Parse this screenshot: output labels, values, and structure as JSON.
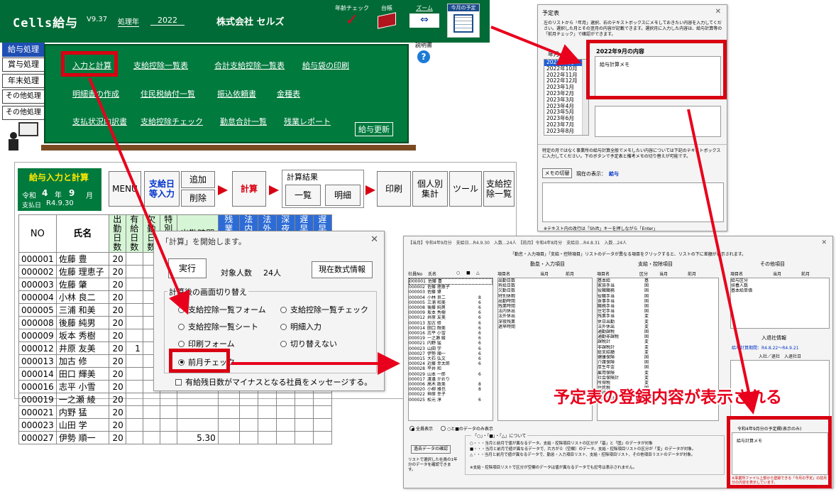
{
  "header": {
    "app_name": "Cells給与",
    "version": "V9.37",
    "year_label": "処理年",
    "year": "2022",
    "company": "株式会社 セルズ",
    "age_check": "年齢チェック",
    "ledger": "台帳",
    "zoom": "ズーム",
    "month_plan": "今月の予定"
  },
  "side_menu": [
    "給与処理",
    "賞与処理",
    "年末処理",
    "その他処理 A",
    "その他処理 B"
  ],
  "help_label": "説明書",
  "menu": {
    "row1": [
      "入力と計算",
      "支給控除一覧表",
      "合計支給控除一覧表",
      "給与袋の印刷"
    ],
    "row2": [
      "明細書の作成",
      "住民税納付一覧",
      "振込依頼書",
      "金種表"
    ],
    "row3": [
      "支払状況内訳書",
      "支給控除チェック",
      "勤怠合計一覧",
      "残業レポート"
    ],
    "update": "給与更新"
  },
  "pay": {
    "title": "給与入力と計算",
    "era": "令和",
    "era_year": "4",
    "year_suffix": "年",
    "month": "9",
    "month_suffix": "月",
    "pay_date_label": "支払日",
    "pay_date": "R4.9.30",
    "buttons": {
      "menu": "MENU",
      "date_input": "支給日等入力",
      "add": "追加",
      "delete": "削除",
      "calc": "計算",
      "result_label": "計算結果",
      "list": "一覧",
      "detail": "明細",
      "print": "印刷",
      "individual": "個人別集計",
      "tools": "ツール",
      "summary": "支給控除一覧"
    },
    "columns": [
      "NO",
      "氏名",
      "出勤日数",
      "有給日数",
      "欠勤日数",
      "特別休暇",
      "出勤時間",
      "残業時間",
      "法内休出",
      "法外休出",
      "深夜残業",
      "遅早回数",
      "遅早時間"
    ],
    "rows": [
      [
        "000001",
        "佐藤 豊",
        "20"
      ],
      [
        "000002",
        "佐藤 理恵子",
        "20"
      ],
      [
        "000003",
        "佐藤 肇",
        "20"
      ],
      [
        "000004",
        "小林 良二",
        "20"
      ],
      [
        "000005",
        "三浦 和美",
        "20"
      ],
      [
        "000008",
        "後藤 純男",
        "20"
      ],
      [
        "000009",
        "坂本 秀樹",
        "20"
      ],
      [
        "000012",
        "井原 友美",
        "20"
      ],
      [
        "000013",
        "加古 修",
        "20"
      ],
      [
        "000014",
        "田口 輝美",
        "20"
      ],
      [
        "000016",
        "志平 小雪",
        "20"
      ],
      [
        "000019",
        "一之瀬 綾",
        "20"
      ],
      [
        "000021",
        "内野 猛",
        "20"
      ],
      [
        "000023",
        "山田 学",
        "20"
      ],
      [
        "000027",
        "伊勢 順一",
        "20"
      ]
    ],
    "extra_one": "1",
    "extra_time": "5.30"
  },
  "calc_dialog": {
    "title": "「計算」を開始します。",
    "run": "実行",
    "target_label": "対象人数",
    "target_count": "24人",
    "formula_info": "現在数式情報",
    "group_label": "計算後の画面切り替え",
    "options_left": [
      "支給控除一覧フォーム",
      "支給控除一覧シート",
      "印刷フォーム",
      "前月チェック"
    ],
    "options_right": [
      "支給控除一覧チェック",
      "明細入力",
      "切り替えない"
    ],
    "selected": "前月チェック",
    "checkbox": "有給残日数がマイナスとなる社員をメッセージする。"
  },
  "schedule": {
    "title": "予定表",
    "instructions": "左のリストから「年月」選択、右のテキストボックスにメモしておきたい内容を入力してください。選択した月とその翌月の内容が記載できます。選択月に入力した内容は、給与計算等の「前月チェック」で確認ができます。",
    "year_month_label": "年月",
    "months": [
      "2022年9月",
      "2022年10月",
      "2022年11月",
      "2022年12月",
      "2023年1月",
      "2023年2月",
      "2023年3月",
      "2023年4月",
      "2023年5月",
      "2023年6月",
      "2023年7月",
      "2023年8月"
    ],
    "content_title": "2022年9月の内容",
    "memo": "給与計算メモ",
    "lower_text": "特定の月ではなく事業所の給与計算全般でメモしたい内容については下記のテキストボックスに入力してください。下のボタンで予定表と備考メモの切り替えが可能です。",
    "toggle_btn": "メモの切替",
    "current_label": "現在の表示：",
    "current_value": "給与",
    "footer": "※テキスト内の改行は「Shift」キーを押しながら「Enter」"
  },
  "check": {
    "title": "【当月】令和4年9月分　支給日…R4.9.30　入数…24人　【前月】令和4年8月分　支給日…R4.8.31　入数…24人",
    "header_note": "「勤怠・入力項目」「支給・控除項目」リストのデータが異なる項目をクリックすると、リストの下に差額が表示されます。",
    "group_attendance": "勤怠・入力項目",
    "group_pay": "支給・控除項目",
    "group_other": "その他項目",
    "emp_headers": [
      "社員No",
      "氏名",
      "○",
      "■",
      "△"
    ],
    "item_headers": [
      "項目名",
      "当月",
      "前月"
    ],
    "pay_headers": [
      "項目名",
      "区分",
      "当月",
      "前月"
    ],
    "employees": [
      [
        "000001",
        "佐藤 豊"
      ],
      [
        "000002",
        "佐藤 理恵子"
      ],
      [
        "000003",
        "佐藤 肇"
      ],
      [
        "000004",
        "小林 良二",
        "8"
      ],
      [
        "000005",
        "三浦 和美",
        "6"
      ],
      [
        "000008",
        "後藤 純男",
        "6"
      ],
      [
        "000009",
        "坂本 秀樹",
        "6"
      ],
      [
        "000012",
        "井原 友美",
        "6"
      ],
      [
        "000013",
        "加古 修",
        "6"
      ],
      [
        "000014",
        "田口 輝美",
        "6"
      ],
      [
        "000016",
        "志平 小雪",
        "6"
      ],
      [
        "000019",
        "一之瀬 綾",
        "6"
      ],
      [
        "000021",
        "内野 猛",
        "6"
      ],
      [
        "000023",
        "山田 学",
        "6"
      ],
      [
        "000027",
        "伊勢 順一",
        "6"
      ],
      [
        "000015",
        "大石 弘文",
        "6"
      ],
      [
        "000024",
        "近藤 幸太郎",
        "6"
      ],
      [
        "000028",
        "平井 和"
      ],
      [
        "000029",
        "山本 一郎",
        "6"
      ],
      [
        "000017",
        "渡邊 かおり"
      ],
      [
        "000006",
        "高木 政美",
        "8"
      ],
      [
        "000020",
        "小柳 雅也",
        "8"
      ],
      [
        "000022",
        "神原 幸子"
      ],
      [
        "000025",
        "松元 淳",
        "6"
      ]
    ],
    "attendance_items": [
      "出勤日数",
      "有給日数",
      "欠勤日数",
      "特別休暇",
      "出勤時間",
      "残業時間",
      "法内休出",
      "法外休出",
      "深夜残業",
      "遅早時間"
    ],
    "pay_items": [
      [
        "基本給",
        "基"
      ],
      [
        "家族手当",
        "固"
      ],
      [
        "役職職務",
        "固"
      ],
      [
        "役職手当",
        "固"
      ],
      [
        "食事手当",
        "固"
      ],
      [
        "職務手当",
        "固"
      ],
      [
        "住宅手当",
        "固"
      ],
      [
        "残業手当",
        "変"
      ],
      [
        "休日出勤",
        "変"
      ],
      [
        "法外休出",
        "変"
      ],
      [
        "通勤課税",
        "固"
      ],
      [
        "通勤非課税",
        "固"
      ],
      [
        "課税計",
        "変"
      ],
      [
        "非課税計",
        "変"
      ],
      [
        "総支給額",
        "変"
      ],
      [
        "健康保険",
        "固"
      ],
      [
        "介護保険",
        "固"
      ],
      [
        "厚生年金",
        "固"
      ],
      [
        "雇用保険",
        "変"
      ],
      [
        "社会保険計",
        "変"
      ],
      [
        "所得税",
        "変"
      ],
      [
        "住民税",
        "固"
      ],
      [
        "控除計",
        "変"
      ],
      [
        "控除合計",
        "変"
      ]
    ],
    "other_items": [
      "給与区分",
      "扶養人数",
      "基本給単価"
    ],
    "hire_info": "入退社情報",
    "period": "給与計算期間：R4.8.22〜R4.9.21",
    "hire_headers": "入社／退社　入退社日",
    "radio_all": "全員表示",
    "radio_marked": "○と■のデータのみ表示",
    "legend_title": "「○」・「■」・「△」について",
    "legend": [
      "○・・・当月と前月で値が異なるデータ。支給・控除項目リストの区分が「基」と「固」のデータが対象",
      "■・・・当月と前月で値が異なるデータで、片方が０（空欄）のデータ。支給・控除項目リストの区分が「変」のデータが対象。",
      "△・・・当月と前月で値が異なるデータで、勤怠・入力項目リスト、支給・控除項目リスト、その他項目リストのデータが対象。"
    ],
    "legend_note": "※支給・控除項目リストで区分が空欄のデータは値が異なるデータでも記号は表示されません。",
    "past_btn": "過去データの確認",
    "past_note": "リストで選択した社員の1年分のデータを確認できます。",
    "plan_title": "令和4年9月分の予定欄(表示のみ)",
    "plan_memo": "給与計算メモ",
    "plan_note": "※事業所ファイル上部から登録できる「今月の予定」の前月分の内容を表示しています。"
  },
  "annotation": "予定表の登録内容が表示される",
  "colors": {
    "green": "#007a3d",
    "red": "#d80012",
    "blue": "#0033cc"
  }
}
